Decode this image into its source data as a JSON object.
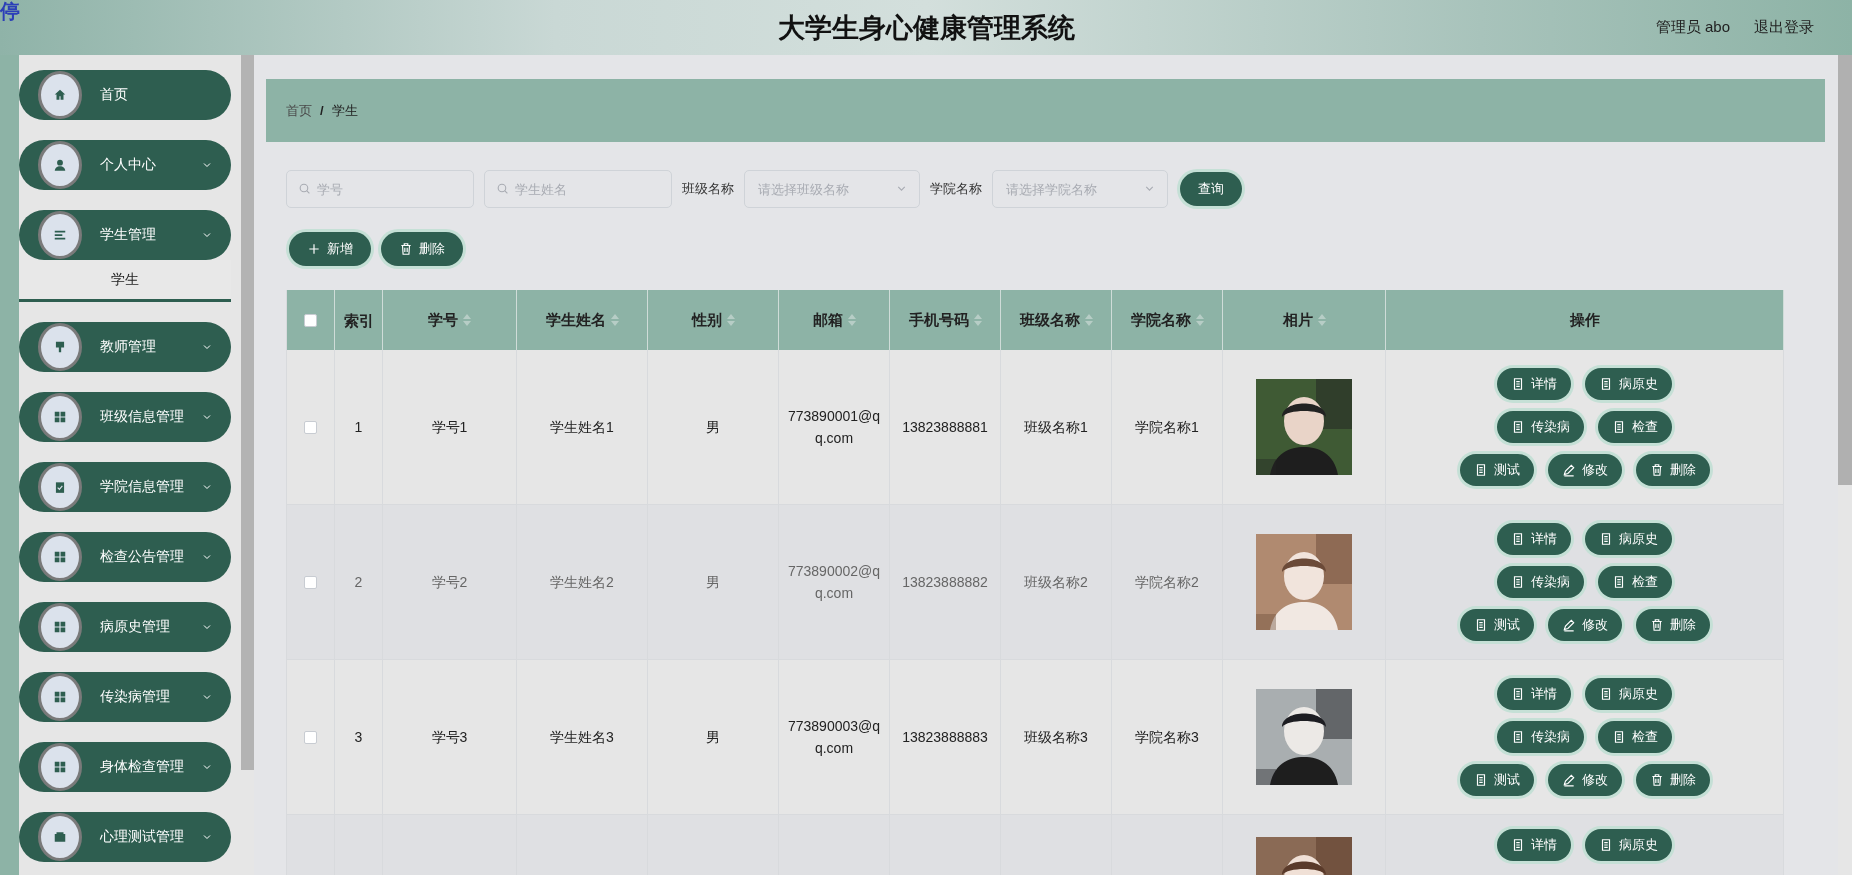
{
  "corner_mark": "停",
  "header": {
    "title": "大学生身心健康管理系统",
    "user": "管理员 abo",
    "logout": "退出登录"
  },
  "sidebar": {
    "items": [
      {
        "label": "首页",
        "has_children": false
      },
      {
        "label": "个人中心",
        "has_children": true
      },
      {
        "label": "学生管理",
        "has_children": true,
        "children": [
          {
            "label": "学生",
            "selected": true
          }
        ]
      },
      {
        "label": "教师管理",
        "has_children": true
      },
      {
        "label": "班级信息管理",
        "has_children": true
      },
      {
        "label": "学院信息管理",
        "has_children": true
      },
      {
        "label": "检查公告管理",
        "has_children": true
      },
      {
        "label": "病原史管理",
        "has_children": true
      },
      {
        "label": "传染病管理",
        "has_children": true
      },
      {
        "label": "身体检查管理",
        "has_children": true
      },
      {
        "label": "心理测试管理",
        "has_children": true
      }
    ]
  },
  "breadcrumb": [
    "首页",
    "学生"
  ],
  "breadcrumb_separator": "/",
  "filters": {
    "student_no": {
      "placeholder": "学号"
    },
    "student_name": {
      "placeholder": "学生姓名"
    },
    "class_label": "班级名称",
    "class_select": {
      "placeholder": "请选择班级名称"
    },
    "college_label": "学院名称",
    "college_select": {
      "placeholder": "请选择学院名称"
    },
    "search_button": "查询"
  },
  "toolbar": [
    {
      "label": "新增",
      "kind": "add"
    },
    {
      "label": "删除",
      "kind": "delete"
    }
  ],
  "table": {
    "all_checked": false,
    "columns": [
      {
        "label": "索引",
        "sortable": false
      },
      {
        "label": "学号",
        "sortable": true
      },
      {
        "label": "学生姓名",
        "sortable": true
      },
      {
        "label": "性别",
        "sortable": true
      },
      {
        "label": "邮箱",
        "sortable": true
      },
      {
        "label": "手机号码",
        "sortable": true
      },
      {
        "label": "班级名称",
        "sortable": true
      },
      {
        "label": "学院名称",
        "sortable": true
      },
      {
        "label": "相片",
        "sortable": true
      },
      {
        "label": "操作",
        "sortable": false
      }
    ],
    "rows": [
      {
        "checked": false,
        "cells": [
          "1",
          "学号1",
          "学生姓名1",
          "男",
          "773890001@qq.com",
          "13823888881",
          "班级名称1",
          "学院名称1"
        ],
        "photo": {
          "kind": "picture"
        },
        "actions": [
          [
            {
              "label": "详情",
              "kind": "doc"
            },
            {
              "label": "病原史",
              "kind": "doc"
            }
          ],
          [
            {
              "label": "传染病",
              "kind": "doc"
            },
            {
              "label": "检查",
              "kind": "doc"
            }
          ],
          [
            {
              "label": "测试",
              "kind": "doc"
            },
            {
              "label": "修改",
              "kind": "edit"
            },
            {
              "label": "删除",
              "kind": "delete"
            }
          ]
        ]
      },
      {
        "checked": false,
        "cells": [
          "2",
          "学号2",
          "学生姓名2",
          "男",
          "773890002@qq.com",
          "13823888882",
          "班级名称2",
          "学院名称2"
        ],
        "photo": {
          "kind": "picture"
        },
        "actions": [
          [
            {
              "label": "详情",
              "kind": "doc"
            },
            {
              "label": "病原史",
              "kind": "doc"
            }
          ],
          [
            {
              "label": "传染病",
              "kind": "doc"
            },
            {
              "label": "检查",
              "kind": "doc"
            }
          ],
          [
            {
              "label": "测试",
              "kind": "doc"
            },
            {
              "label": "修改",
              "kind": "edit"
            },
            {
              "label": "删除",
              "kind": "delete"
            }
          ]
        ]
      },
      {
        "checked": false,
        "cells": [
          "3",
          "学号3",
          "学生姓名3",
          "男",
          "773890003@qq.com",
          "13823888883",
          "班级名称3",
          "学院名称3"
        ],
        "photo": {
          "kind": "picture"
        },
        "actions": [
          [
            {
              "label": "详情",
              "kind": "doc"
            },
            {
              "label": "病原史",
              "kind": "doc"
            }
          ],
          [
            {
              "label": "传染病",
              "kind": "doc"
            },
            {
              "label": "检查",
              "kind": "doc"
            }
          ],
          [
            {
              "label": "测试",
              "kind": "doc"
            },
            {
              "label": "修改",
              "kind": "edit"
            },
            {
              "label": "删除",
              "kind": "delete"
            }
          ]
        ]
      },
      {
        "cells": [],
        "photo": {
          "kind": "picture"
        },
        "actions": [
          [
            {
              "label": "详情",
              "kind": "doc"
            },
            {
              "label": "病原史",
              "kind": "doc"
            }
          ]
        ]
      }
    ]
  }
}
